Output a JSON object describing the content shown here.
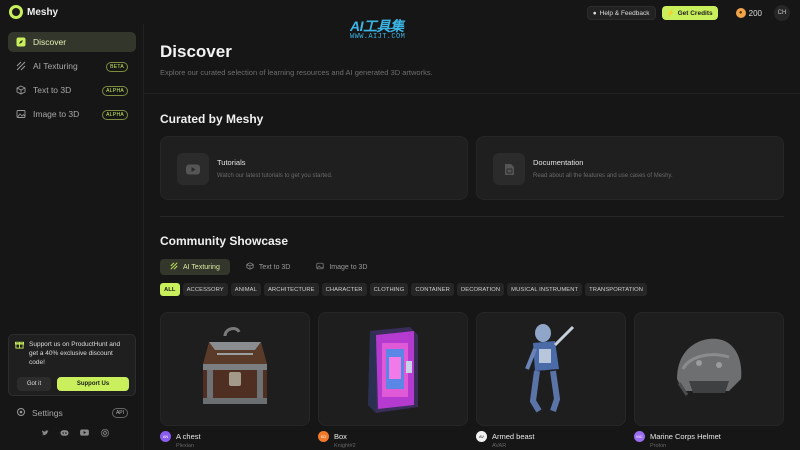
{
  "app": {
    "name": "Meshy"
  },
  "watermark": {
    "main": "AI工具集",
    "sub": "WWW.AIJT.COM"
  },
  "header": {
    "help_label": "Help & Feedback",
    "credits_label": "Get Credits",
    "credit_count": "200",
    "user_initials": "CH"
  },
  "sidebar": {
    "items": [
      {
        "label": "Discover",
        "icon": "compass-icon",
        "badge": ""
      },
      {
        "label": "AI Texturing",
        "icon": "texture-icon",
        "badge": "BETA"
      },
      {
        "label": "Text to 3D",
        "icon": "cube-icon",
        "badge": "ALPHA"
      },
      {
        "label": "Image to 3D",
        "icon": "image-icon",
        "badge": "ALPHA"
      }
    ],
    "promo": {
      "text": "Support us on ProductHunt and get a 40% exclusive discount code!",
      "dismiss_label": "Got it",
      "action_label": "Support Us"
    },
    "settings_label": "Settings",
    "settings_badge": "API",
    "socials": [
      "twitter-icon",
      "discord-icon",
      "youtube-icon",
      "instagram-icon"
    ]
  },
  "main": {
    "title": "Discover",
    "subtitle": "Explore our curated selection of learning resources and AI generated 3D artworks.",
    "curated_title": "Curated by Meshy",
    "resources": [
      {
        "title": "Tutorials",
        "description": "Watch our latest tutorials to get you started.",
        "icon": "youtube-icon"
      },
      {
        "title": "Documentation",
        "description": "Read about all the features and use cases of Meshy.",
        "icon": "document-icon"
      }
    ],
    "showcase_title": "Community Showcase",
    "tabs": [
      {
        "label": "AI Texturing",
        "active": true
      },
      {
        "label": "Text to 3D",
        "active": false
      },
      {
        "label": "Image to 3D",
        "active": false
      }
    ],
    "categories": [
      "ALL",
      "ACCESSORY",
      "ANIMAL",
      "ARCHITECTURE",
      "CHARACTER",
      "CLOTHING",
      "CONTAINER",
      "DECORATION",
      "MUSICAL INSTRUMENT",
      "TRANSPORTATION"
    ],
    "selected_category": "ALL",
    "cards": [
      {
        "title": "A chest",
        "author": "Plexian",
        "avatar": "AN",
        "avatar_color": "#8a5cf0"
      },
      {
        "title": "Box",
        "author": "Knight#2",
        "avatar": "KD",
        "avatar_color": "#f07a2a"
      },
      {
        "title": "Armed beast",
        "author": "AVAR",
        "avatar": "AV",
        "avatar_color": "#f2f2f2"
      },
      {
        "title": "Marine Corps Helmet",
        "author": "Proton",
        "avatar": "MC",
        "avatar_color": "#9b6cf0"
      }
    ]
  }
}
